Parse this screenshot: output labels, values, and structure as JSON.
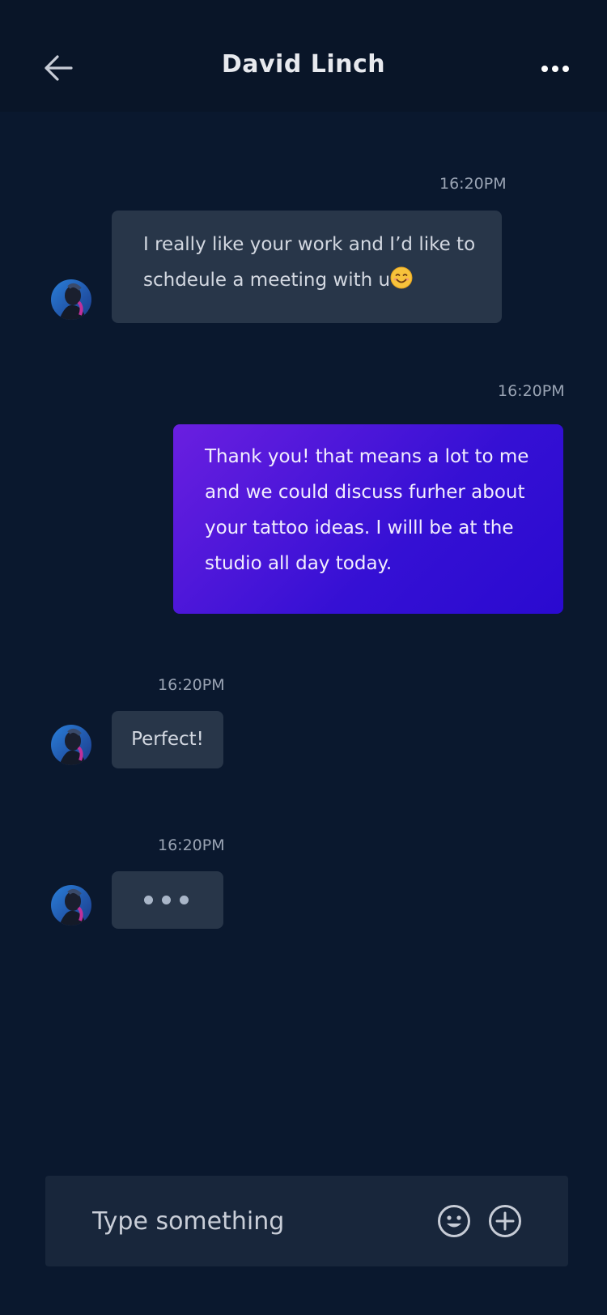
{
  "header": {
    "title": "David Linch",
    "back_icon": "arrow-left-icon",
    "more_icon": "more-horizontal-icon"
  },
  "messages": [
    {
      "direction": "incoming",
      "time": "16:20PM",
      "text": "I really like your work and I’d like to",
      "text_line2": "schdeule a meeting with u",
      "emoji": "smiling-face-emoji"
    },
    {
      "direction": "outgoing",
      "time": "16:20PM",
      "lines": [
        "Thank you! that means a lot to me",
        "and we could discuss furher about",
        "your tattoo ideas. I willl be at the",
        "studio all day today."
      ]
    },
    {
      "direction": "incoming",
      "time": "16:20PM",
      "text": "Perfect!"
    },
    {
      "direction": "incoming",
      "time": "16:20PM",
      "typing": true
    }
  ],
  "composer": {
    "placeholder": "Type something",
    "emoji_icon": "smiley-icon",
    "add_icon": "plus-circle-icon"
  },
  "colors": {
    "background": "#0a182e",
    "incoming_bubble": "#283649",
    "outgoing_gradient_start": "#6a1fe0",
    "outgoing_gradient_end": "#2a0ad0"
  }
}
